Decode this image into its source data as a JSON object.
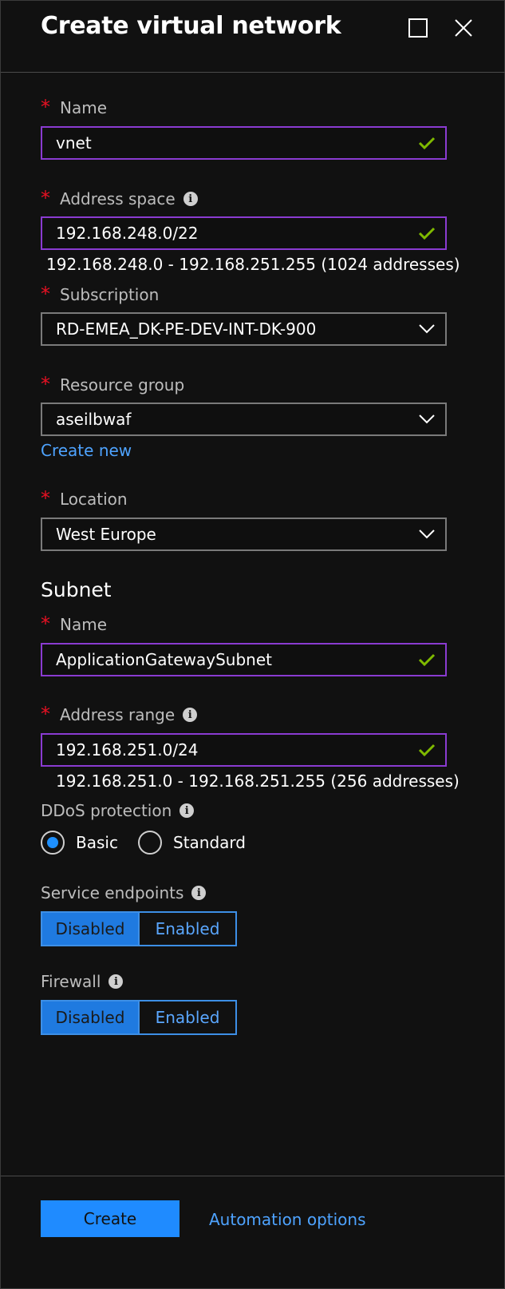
{
  "header": {
    "title": "Create virtual network"
  },
  "form": {
    "name": {
      "label": "Name",
      "value": "vnet"
    },
    "address_space": {
      "label": "Address space",
      "value": "192.168.248.0/22",
      "hint": "192.168.248.0 - 192.168.251.255 (1024 addresses)"
    },
    "subscription": {
      "label": "Subscription",
      "value": "RD-EMEA_DK-PE-DEV-INT-DK-900"
    },
    "resource_group": {
      "label": "Resource group",
      "value": "aseilbwaf",
      "create_new": "Create new"
    },
    "location": {
      "label": "Location",
      "value": "West Europe"
    }
  },
  "subnet": {
    "heading": "Subnet",
    "name": {
      "label": "Name",
      "value": "ApplicationGatewaySubnet"
    },
    "address_range": {
      "label": "Address range",
      "value": "192.168.251.0/24",
      "hint": "192.168.251.0 - 192.168.251.255 (256 addresses)"
    }
  },
  "ddos": {
    "label": "DDoS protection",
    "options": [
      "Basic",
      "Standard"
    ],
    "selected": "Basic"
  },
  "service_endpoints": {
    "label": "Service endpoints",
    "options": [
      "Disabled",
      "Enabled"
    ],
    "selected": "Disabled"
  },
  "firewall": {
    "label": "Firewall",
    "options": [
      "Disabled",
      "Enabled"
    ],
    "selected": "Disabled"
  },
  "footer": {
    "create_label": "Create",
    "automation_label": "Automation options"
  },
  "colors": {
    "required": "#e81123",
    "valid_check": "#7fba00",
    "accent": "#1f8bff",
    "valid_border": "#8a3bd1"
  },
  "icons": {
    "required": "*",
    "info": "i"
  }
}
